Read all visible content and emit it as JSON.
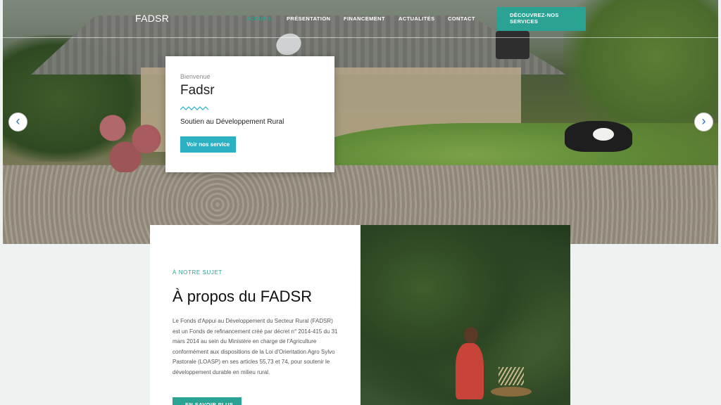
{
  "nav": {
    "brand": "FADSR",
    "items": [
      {
        "label": "ACCUEIL",
        "active": true
      },
      {
        "label": "PRÉSENTATION",
        "active": false
      },
      {
        "label": "FINANCEMENT",
        "active": false
      },
      {
        "label": "ACTUALITÉS",
        "active": false
      },
      {
        "label": "CONTACT",
        "active": false
      }
    ],
    "cta_line1": "DÉCOUVREZ-NOS",
    "cta_line2": "SERVICES"
  },
  "hero": {
    "eyebrow": "Bienvenue",
    "title": "Fadsr",
    "subtitle": "Soutien au Développement Rural",
    "button": "Voir nos service",
    "prev_icon": "chevron-left-icon",
    "next_icon": "chevron-right-icon"
  },
  "about": {
    "eyebrow": "À NOTRE SUJET",
    "title": "À propos du FADSR",
    "body": "Le Fonds d'Appui au Développement du Secteur Rural (FADSR) est un Fonds de refinancement créé par décret n° 2014-415 du 31 mars 2014 au sein du Ministère en charge de l'Agriculture conformément aux dispositions de la Loi d'Orientation Agro Sylvo Pastorale (LOASP) en ses articles 55,73 et 74, pour soutenir le développement durable en milieu rural.",
    "button": "EN SAVOIR PLUS"
  },
  "colors": {
    "accent": "#2aa394",
    "hero_button": "#2bb1c3",
    "active_nav": "#2fa08e"
  }
}
